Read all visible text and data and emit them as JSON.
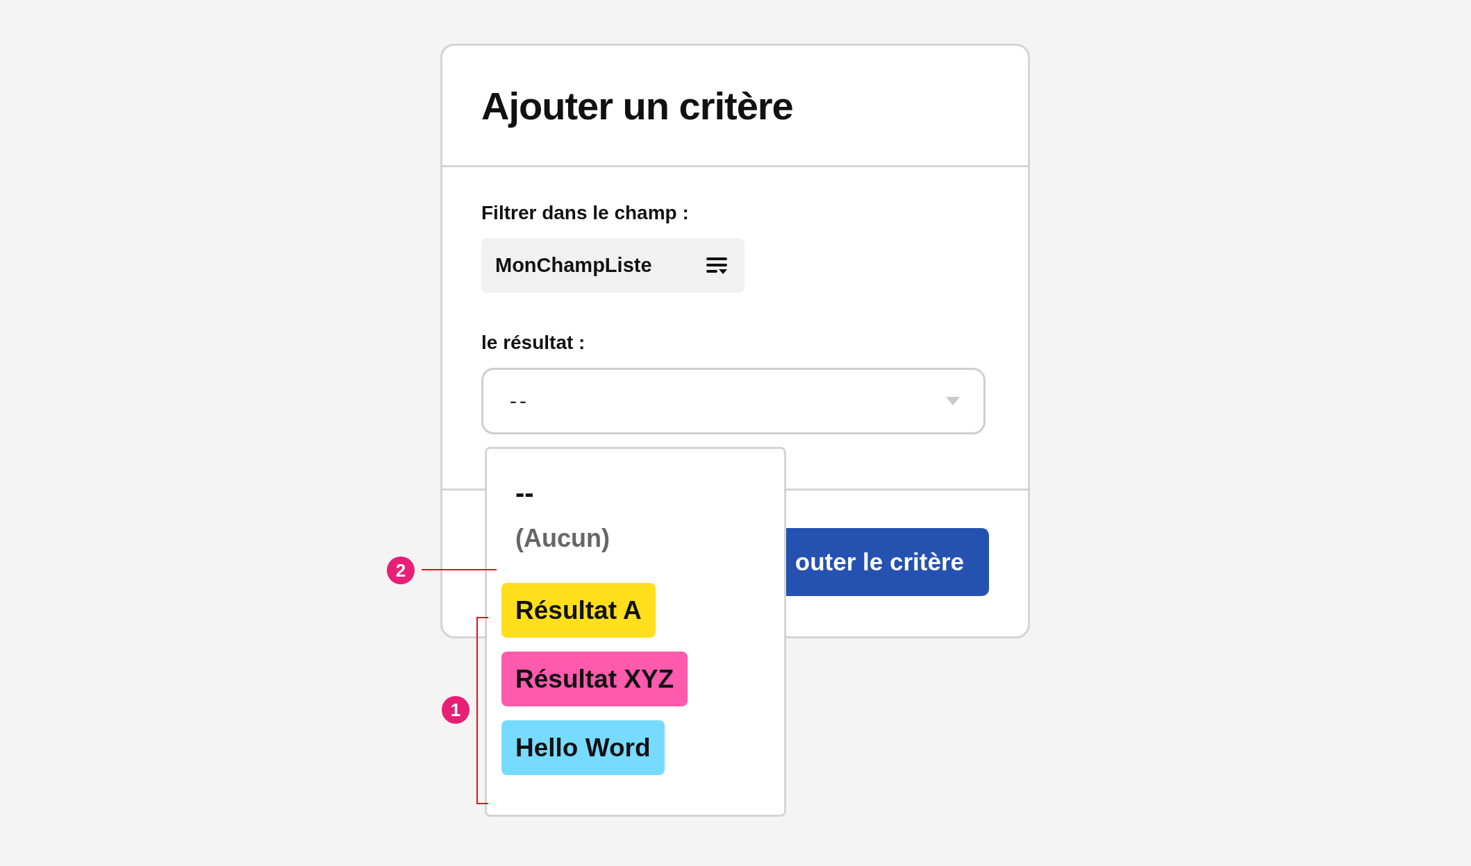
{
  "dialog": {
    "title": "Ajouter un critère"
  },
  "field_filter": {
    "label": "Filtrer dans le champ :",
    "value": "MonChampListe"
  },
  "field_result": {
    "label": "le résultat :",
    "value": "--",
    "expanded": true
  },
  "dropdown": {
    "options": [
      {
        "kind": "placeholder",
        "label": "--"
      },
      {
        "kind": "none",
        "label": "(Aucun)"
      },
      {
        "kind": "tag",
        "label": "Résultat A",
        "color": "#ffdf1b"
      },
      {
        "kind": "tag",
        "label": "Résultat XYZ",
        "color": "#ff5aad"
      },
      {
        "kind": "tag",
        "label": "Hello Word",
        "color": "#77dbff"
      }
    ]
  },
  "button": {
    "label": "outer le critère"
  },
  "annotations": [
    {
      "kind": "line",
      "number": "2"
    },
    {
      "kind": "bracket",
      "number": "1"
    }
  ]
}
